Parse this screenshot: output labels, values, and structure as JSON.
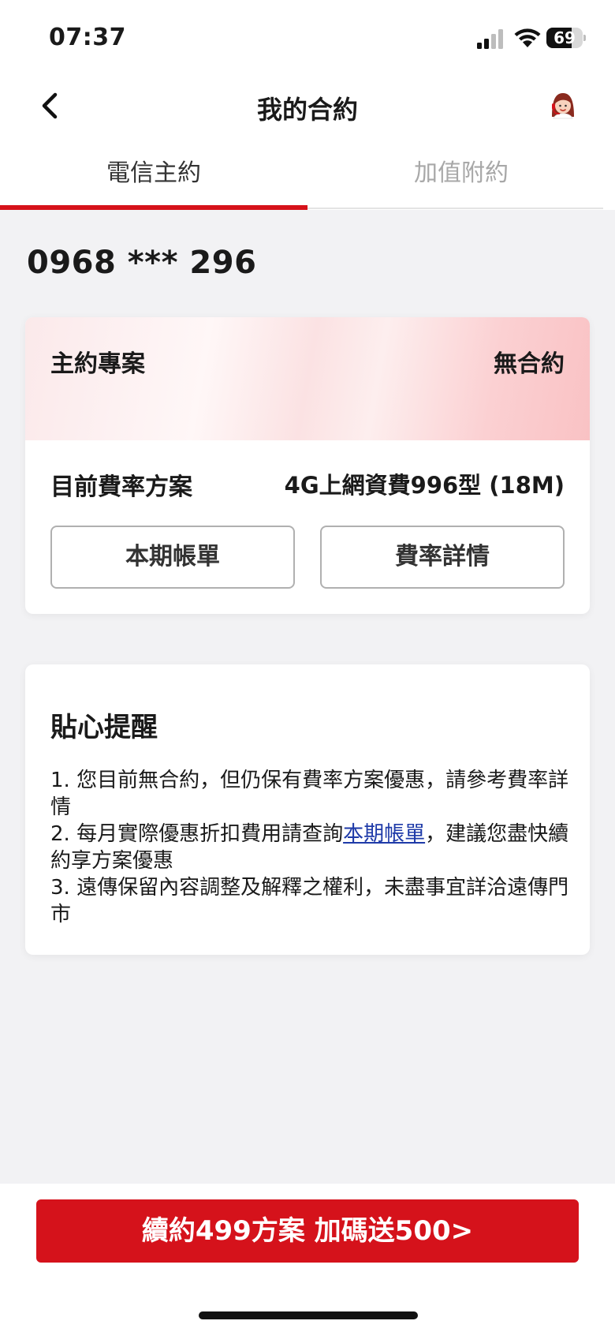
{
  "status_bar": {
    "time": "07:37",
    "battery": "69",
    "battery_level": 0.69,
    "icons": [
      "cellular-signal-icon",
      "wifi-icon",
      "battery-icon"
    ]
  },
  "nav": {
    "title": "我的合約",
    "back_icon": "chevron-left-icon",
    "avatar_icon": "customer-service-avatar-icon"
  },
  "tabs": [
    {
      "label": "電信主約",
      "active": true
    },
    {
      "label": "加值附約",
      "active": false
    }
  ],
  "phone_number": "0968 *** 296",
  "plan_card": {
    "header_label": "主約專案",
    "header_value": "無合約",
    "rate_label": "目前費率方案",
    "rate_value": "4G上網資費996型 (18M)",
    "bill_button": "本期帳單",
    "rate_details_button": "費率詳情"
  },
  "reminder": {
    "title": "貼心提醒",
    "item1": "1. 您目前無合約，但仍保有費率方案優惠，請參考費率詳情",
    "item2_prefix": "2. 每月實際優惠折扣費用請查詢",
    "item2_link": "本期帳單",
    "item2_suffix": "，建議您盡快續約享方案優惠",
    "item3": "3. 遠傳保留內容調整及解釋之權利，未盡事宜詳洽遠傳門市"
  },
  "cta_button": "續約499方案 加碼送500>",
  "colors": {
    "brand_red": "#d5121b",
    "tab_underline": "#d6121a",
    "link_blue": "#1e3aa8",
    "page_bg": "#f2f2f4"
  }
}
